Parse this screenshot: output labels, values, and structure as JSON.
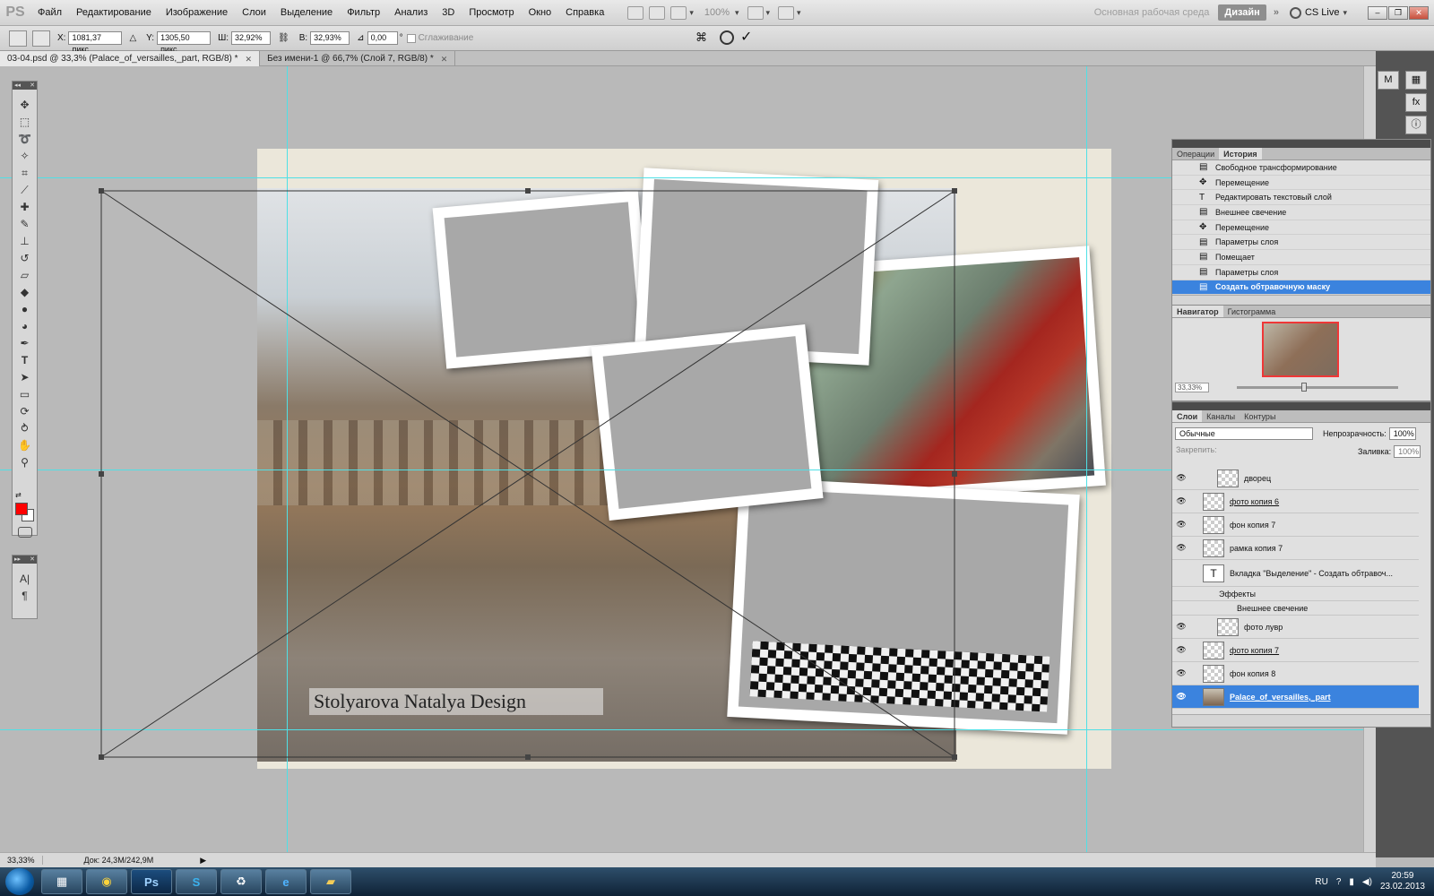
{
  "app": {
    "logo": "PS"
  },
  "menu": [
    "Файл",
    "Редактирование",
    "Изображение",
    "Слои",
    "Выделение",
    "Фильтр",
    "Анализ",
    "3D",
    "Просмотр",
    "Окно",
    "Справка"
  ],
  "menubar": {
    "zoom": "100%",
    "workspace_main": "Основная рабочая среда",
    "workspace_active": "Дизайн",
    "more": "»",
    "cslive": "CS Live"
  },
  "options": {
    "x_label": "X:",
    "x_value": "1081,37 пикс",
    "y_label": "Y:",
    "y_value": "1305,50 пикс",
    "w_label": "Ш:",
    "w_value": "32,92%",
    "h_label": "В:",
    "h_value": "32,93%",
    "angle_value": "0,00",
    "angle_unit": "°",
    "interpolation": "Сглаживание"
  },
  "tabs": [
    {
      "label": "03-04.psd @ 33,3% (Palace_of_versailles,_part, RGB/8) *"
    },
    {
      "label": "Без имени-1 @ 66,7% (Слой 7, RGB/8) *"
    }
  ],
  "document": {
    "signature_part1": "Stolyarova Natalya Design"
  },
  "history": {
    "tabs": [
      "Операции",
      "История"
    ],
    "active_tab": 1,
    "items": [
      "Свободное трансформирование",
      "Перемещение",
      "Редактировать текстовый слой",
      "Внешнее свечение",
      "Перемещение",
      "Параметры слоя",
      "Помещает",
      "Параметры слоя",
      "Создать обтравочную маску"
    ],
    "selected": 8
  },
  "navigator": {
    "tabs": [
      "Навигатор",
      "Гистограмма"
    ],
    "zoom": "33,33%"
  },
  "layers": {
    "tabs": [
      "Слои",
      "Каналы",
      "Контуры"
    ],
    "blend_mode": "Обычные",
    "opacity_label": "Непрозрачность:",
    "opacity": "100%",
    "lock_label": "Закрепить:",
    "fill_label": "Заливка:",
    "fill": "100%",
    "items": [
      "дворец",
      "фото копия 6",
      "фон копия 7",
      "рамка копия 7",
      "Вкладка \"Выделение\" - Создать обтравоч...",
      "Эффекты",
      "Внешнее свечение",
      "фото лувр",
      "фото копия 7",
      "фон копия 8",
      "Palace_of_versailles,_part"
    ],
    "selected": 10
  },
  "status": {
    "zoom": "33,33%",
    "doc": "Док: 24,3M/242,9M"
  },
  "tray": {
    "lang": "RU",
    "time": "20:59",
    "date": "23.02.2013"
  },
  "colors": {
    "foreground": "#ff0000",
    "background": "#ffffff",
    "guide": "#4fe0e6",
    "selection": "#3b83de"
  }
}
